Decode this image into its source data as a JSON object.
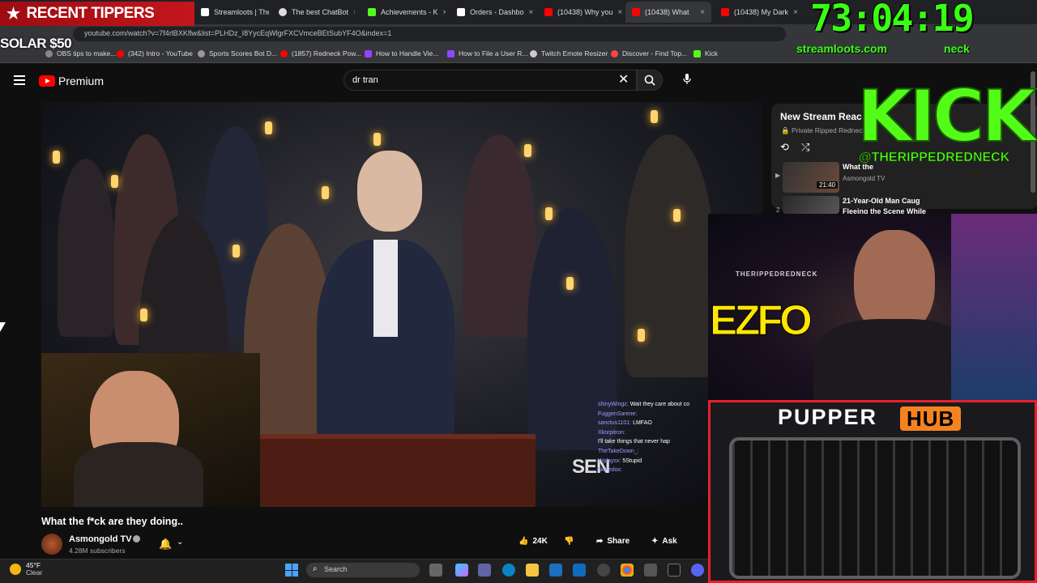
{
  "browser": {
    "tabs": [
      {
        "label": "Streamloots | The",
        "color": "#ffffff"
      },
      {
        "label": "The best ChatBot",
        "color": "#dddddd"
      },
      {
        "label": "Achievements - K",
        "color": "#53fc18"
      },
      {
        "label": "Orders - Dashbo",
        "color": "#ffffff"
      },
      {
        "label": "(10438) Why you",
        "color": "#ff0000"
      },
      {
        "label": "(10438) What",
        "color": "#ff0000"
      },
      {
        "label": "(10438) My Dark",
        "color": "#ff0000"
      }
    ],
    "url": "youtube.com/watch?v=7f4rlBXKflw&list=PLHDz_I8YycEqWlgrFXCVmceBEtSubYF4O&index=1",
    "bookmarks": [
      {
        "label": "OBS tips to make...",
        "color": "#888888"
      },
      {
        "label": "(342) Intro - YouTube",
        "color": "#ff0000"
      },
      {
        "label": "Sports Scores Bot D...",
        "color": "#999999"
      },
      {
        "label": "(1857) Redneck Pow...",
        "color": "#ff0000"
      },
      {
        "label": "How to Handle Vie...",
        "color": "#9146ff"
      },
      {
        "label": "How to File a User R...",
        "color": "#9146ff"
      },
      {
        "label": "Twitch Emote Resizer",
        "color": "#cccccc"
      },
      {
        "label": "Discover - Find Top...",
        "color": "#ff4444"
      },
      {
        "label": "Kick",
        "color": "#53fc18"
      }
    ]
  },
  "overlays": {
    "recent_tippers": "RECENT TIPPERS",
    "solar_tip": "SOLAR $50",
    "timer": "73:04:19",
    "streamloots": "streamloots.com",
    "streamloots_tail": "neck",
    "kick_logo": "KICK",
    "kick_handle": "@THERIPPEDREDNECK",
    "ezfo": "EZFO",
    "cam_banner": "THERIPPEDREDNECK",
    "pupper": "PUPPER",
    "hub": "HUB"
  },
  "youtube": {
    "brand": "Premium",
    "search_value": "dr tran",
    "video_title": "What the f*ck are they doing..",
    "channel": "Asmongold TV",
    "subscribers": "4.28M subscribers",
    "likes": "24K",
    "share": "Share",
    "ask": "Ask",
    "overlay_text": "SEN",
    "chat": [
      {
        "user": "shinyWingz:",
        "msg": "Wait they care about co"
      },
      {
        "user": "FuggenSarene:",
        "msg": ""
      },
      {
        "user": "sanctus1101:",
        "msg": "LMFAO"
      },
      {
        "user": "Xkorpitron:",
        "msg": ""
      },
      {
        "user": "",
        "msg": "I'll take things that never hap"
      },
      {
        "user": "TheTakeDown_:",
        "msg": ""
      },
      {
        "user": "Wplaysx:",
        "msg": "5Stupid"
      },
      {
        "user": "Neeedox:",
        "msg": ""
      }
    ]
  },
  "playlist": {
    "title": "New Stream Reac",
    "subtitle": "Private  Ripped Redneck",
    "items": [
      {
        "title": "What the",
        "channel": "Asmongold TV",
        "duration": "21:40"
      },
      {
        "title": "21-Year-Old Man Caug",
        "title2": "Fleeing the Scene While"
      }
    ],
    "item_num": "2"
  },
  "taskbar": {
    "temperature": "45°F",
    "condition": "Clear",
    "search_placeholder": "Search"
  }
}
